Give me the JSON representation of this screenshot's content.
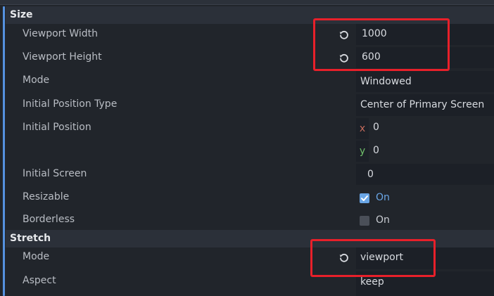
{
  "sections": {
    "size": {
      "title": "Size",
      "viewport_width": {
        "label": "Viewport Width",
        "value": "1000"
      },
      "viewport_height": {
        "label": "Viewport Height",
        "value": "600"
      },
      "mode": {
        "label": "Mode",
        "value": "Windowed"
      },
      "initial_position_type": {
        "label": "Initial Position Type",
        "value": "Center of Primary Screen"
      },
      "initial_position": {
        "label": "Initial Position",
        "x_axis": "x",
        "x_value": "0",
        "y_axis": "y",
        "y_value": "0"
      },
      "initial_screen": {
        "label": "Initial Screen",
        "value": "0"
      },
      "resizable": {
        "label": "Resizable",
        "checked": true,
        "value_label": "On"
      },
      "borderless": {
        "label": "Borderless",
        "checked": false,
        "value_label": "On"
      }
    },
    "stretch": {
      "title": "Stretch",
      "mode": {
        "label": "Mode",
        "value": "viewport"
      },
      "aspect": {
        "label": "Aspect",
        "value": "keep"
      }
    }
  },
  "icons": {
    "reset": "reset-arrow-icon",
    "check": "checkmark-icon"
  },
  "colors": {
    "accent": "#6aa6e6",
    "highlight": "#e8202a",
    "axis_x": "#c56b5c",
    "axis_y": "#6fbf6a"
  }
}
